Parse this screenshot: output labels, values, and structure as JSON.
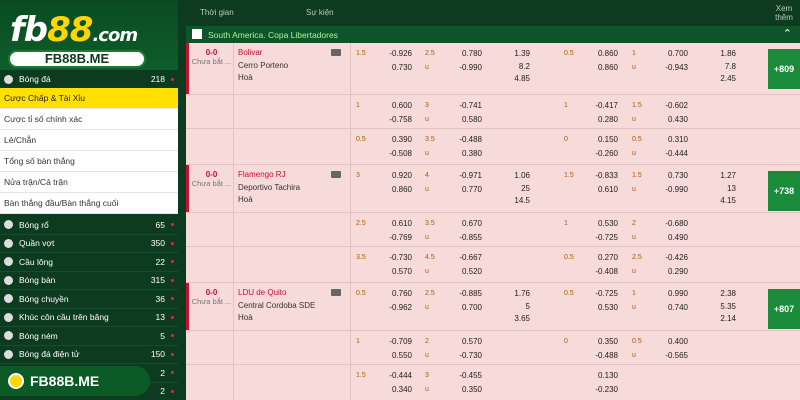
{
  "brand": {
    "logo_text_1": "fb",
    "logo_text_2": "88",
    "logo_text_3": ".com",
    "pill": "FB88B.ME",
    "bottom_badge": "FB88B.ME"
  },
  "sidebar": {
    "top": {
      "label": "Bóng đá",
      "count": "218"
    },
    "submenu": [
      {
        "label": "Cược Chấp & Tài Xỉu",
        "active": true
      },
      {
        "label": "Cược tỉ số chính xác"
      },
      {
        "label": "Lẻ/Chẵn"
      },
      {
        "label": "Tổng số bàn thắng"
      },
      {
        "label": "Nửa trận/Cả trận"
      },
      {
        "label": "Bàn thắng đầu/Bàn thắng cuối"
      }
    ],
    "sports": [
      {
        "label": "Bóng rổ",
        "count": "65",
        "icon": "basketball-icon"
      },
      {
        "label": "Quần vợt",
        "count": "350",
        "icon": "tennis-icon"
      },
      {
        "label": "Cầu lông",
        "count": "22",
        "icon": "badminton-icon"
      },
      {
        "label": "Bóng bàn",
        "count": "315",
        "icon": "table-tennis-icon"
      },
      {
        "label": "Bóng chuyền",
        "count": "36",
        "icon": "volleyball-icon"
      },
      {
        "label": "Khúc côn cầu trên băng",
        "count": "13",
        "icon": "ice-hockey-icon"
      },
      {
        "label": "Bóng ném",
        "count": "5",
        "icon": "handball-icon"
      },
      {
        "label": "Bóng đá điện tử",
        "count": "150",
        "icon": "esoccer-icon"
      },
      {
        "label": "",
        "count": "2",
        "icon": "sport-icon"
      },
      {
        "label": "",
        "count": "2",
        "icon": "sport-icon"
      }
    ]
  },
  "header": {
    "col_time": "Thời gian",
    "col_event": "Sự kiện",
    "col_more": "Xem thêm"
  },
  "league": {
    "name": "South America. Copa Libertadores"
  },
  "matches": [
    {
      "score": "0-0",
      "status": "Chưa bắt ...",
      "home": "Bolivar",
      "away": "Cerro Porteno",
      "draw": "Hoà",
      "more": "+809",
      "rows": [
        {
          "h1": "1.5",
          "h1a": "-0.926",
          "h1b": "0.730",
          "ou1": "2.5",
          "ou1a": "0.780",
          "ou1b": "-0.990",
          "x1": [
            "1.39",
            "8.2",
            "4.85"
          ],
          "h2": "0.5",
          "h2a": "0.860",
          "h2b": "0.860",
          "ou2": "1",
          "ou2a": "0.700",
          "ou2b": "-0.943",
          "x2": [
            "1.86",
            "7.8",
            "2.45"
          ]
        },
        {
          "h1": "1",
          "h1a": "0.600",
          "h1b": "-0.758",
          "ou1": "3",
          "ou1a": "-0.741",
          "ou1b": "0.580",
          "x1": [],
          "h2": "1",
          "h2a": "-0.417",
          "h2b": "0.280",
          "ou2": "1.5",
          "ou2a": "-0.602",
          "ou2b": "0.430",
          "x2": []
        },
        {
          "h1": "0.5",
          "h1a": "0.390",
          "h1b": "-0.508",
          "ou1": "3.5",
          "ou1a": "-0.488",
          "ou1b": "0.380",
          "x1": [],
          "h2": "0",
          "h2a": "0.150",
          "h2b": "-0.260",
          "ou2": "0.5",
          "ou2a": "0.310",
          "ou2b": "-0.444",
          "x2": []
        }
      ]
    },
    {
      "score": "0-0",
      "status": "Chưa bắt ...",
      "home": "Flamengo RJ",
      "away": "Deportivo Tachira",
      "draw": "Hoà",
      "more": "+738",
      "rows": [
        {
          "h1": "3",
          "h1a": "0.920",
          "h1b": "0.860",
          "ou1": "4",
          "ou1a": "-0.971",
          "ou1b": "0.770",
          "x1": [
            "1.06",
            "25",
            "14.5"
          ],
          "h2": "1.5",
          "h2a": "-0.833",
          "h2b": "0.610",
          "ou2": "1.5",
          "ou2a": "0.730",
          "ou2b": "-0.990",
          "x2": [
            "1.27",
            "13",
            "4.15"
          ]
        },
        {
          "h1": "2.5",
          "h1a": "0.610",
          "h1b": "-0.769",
          "ou1": "3.5",
          "ou1a": "0.670",
          "ou1b": "-0.855",
          "x1": [],
          "h2": "1",
          "h2a": "0.530",
          "h2b": "-0.725",
          "ou2": "2",
          "ou2a": "-0.680",
          "ou2b": "0.490",
          "x2": []
        },
        {
          "h1": "3.5",
          "h1a": "-0.730",
          "h1b": "0.570",
          "ou1": "4.5",
          "ou1a": "-0.667",
          "ou1b": "0.520",
          "x1": [],
          "h2": "0.5",
          "h2a": "0.270",
          "h2b": "-0.408",
          "ou2": "2.5",
          "ou2a": "-0.426",
          "ou2b": "0.290",
          "x2": []
        }
      ]
    },
    {
      "score": "0-0",
      "status": "Chưa bắt ...",
      "home": "LDU de Quito",
      "away": "Central Cordoba SDE",
      "draw": "Hoà",
      "more": "+807",
      "rows": [
        {
          "h1": "0.5",
          "h1a": "0.760",
          "h1b": "-0.962",
          "ou1": "2.5",
          "ou1a": "-0.885",
          "ou1b": "0.700",
          "x1": [
            "1.76",
            "5",
            "3.65"
          ],
          "h2": "0.5",
          "h2a": "-0.725",
          "h2b": "0.530",
          "ou2": "1",
          "ou2a": "0.990",
          "ou2b": "0.740",
          "x2": [
            "2.38",
            "5.35",
            "2.14"
          ]
        },
        {
          "h1": "1",
          "h1a": "-0.709",
          "h1b": "0.550",
          "ou1": "2",
          "ou1a": "0.570",
          "ou1b": "-0.730",
          "x1": [],
          "h2": "0",
          "h2a": "0.350",
          "h2b": "-0.488",
          "ou2": "0.5",
          "ou2a": "0.400",
          "ou2b": "-0.565",
          "x2": []
        },
        {
          "h1": "1.5",
          "h1a": "-0.444",
          "h1b": "0.340",
          "ou1": "3",
          "ou1a": "-0.455",
          "ou1b": "0.350",
          "x1": [],
          "h2": "",
          "h2a": "0.130",
          "h2b": "-0.230",
          "ou2": "",
          "ou2a": "",
          "ou2b": "",
          "x2": []
        }
      ]
    }
  ],
  "colors": {
    "accent": "#ffe000",
    "brand_green": "#0d3b1f",
    "score_red": "#c8102e",
    "plus_green": "#1a8a3b"
  }
}
